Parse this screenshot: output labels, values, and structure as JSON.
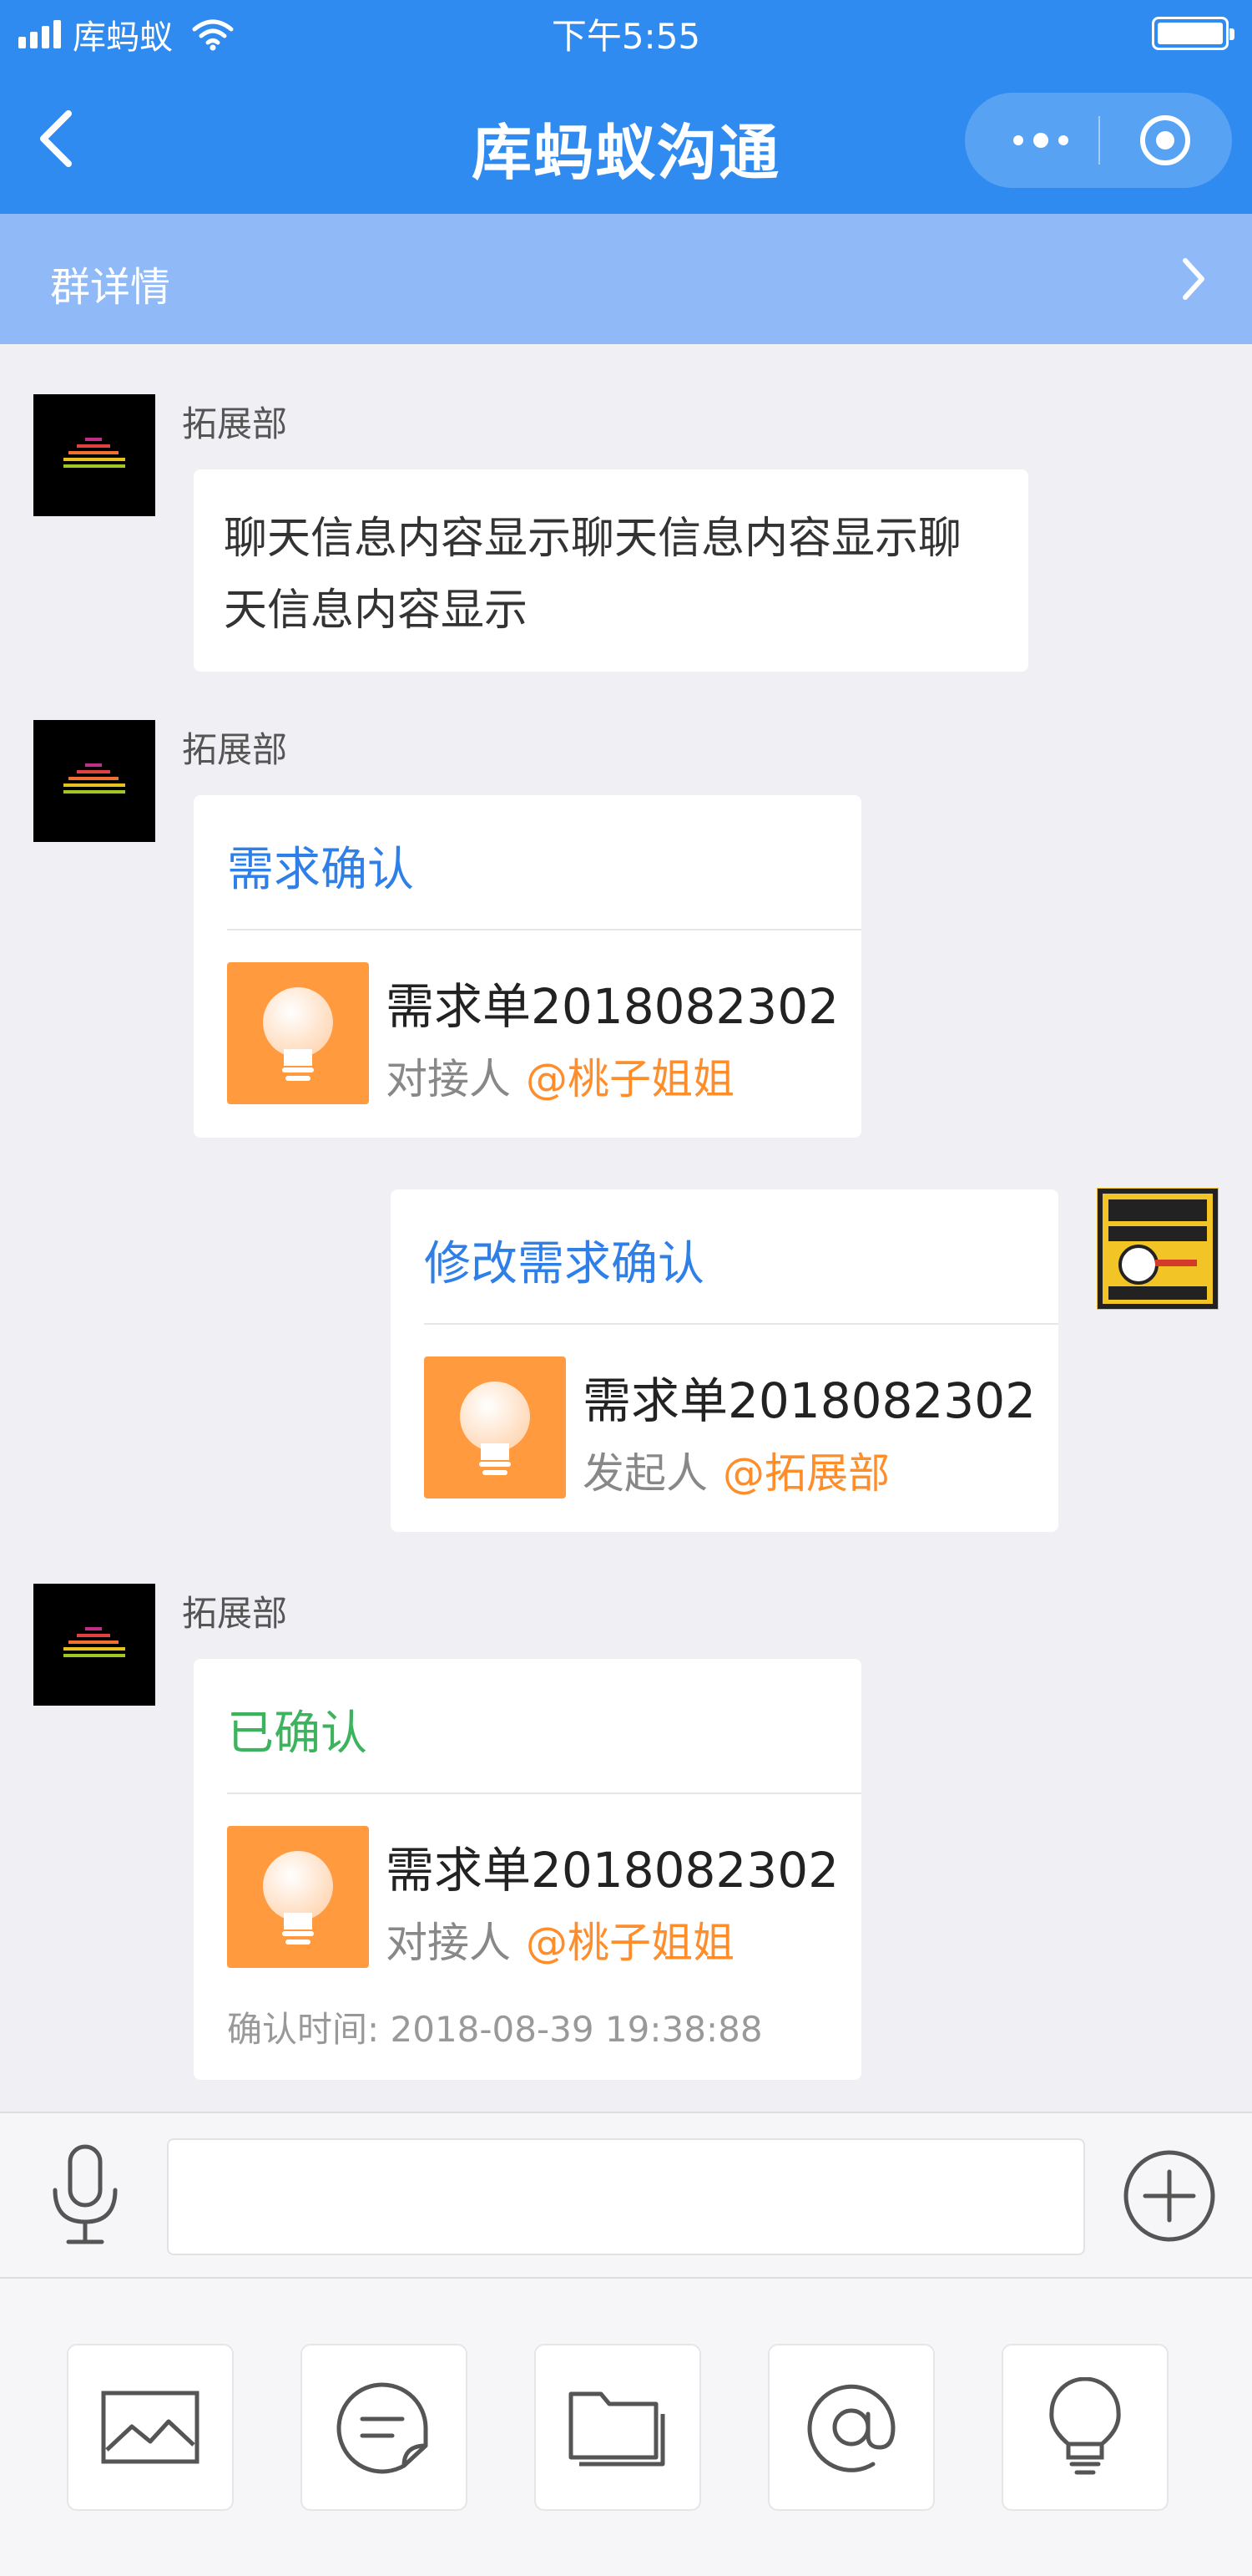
{
  "status_bar": {
    "carrier": "库蚂蚁",
    "time": "下午5:55"
  },
  "nav": {
    "title": "库蚂蚁沟通"
  },
  "group_bar": {
    "label": "群详情"
  },
  "messages": [
    {
      "type": "text",
      "side": "left",
      "sender": "拓展部",
      "text": "聊天信息内容显示聊天信息内容显示聊天信息内容显示"
    },
    {
      "type": "card",
      "side": "left",
      "sender": "拓展部",
      "title": "需求确认",
      "title_color": "#2f7fe8",
      "doc": "需求单2018082302",
      "person_label": "对接人",
      "mention": "@桃子姐姐"
    },
    {
      "type": "card",
      "side": "right",
      "title": "修改需求确认",
      "title_color": "#2f7fe8",
      "doc": "需求单2018082302",
      "person_label": "发起人",
      "mention": "@拓展部"
    },
    {
      "type": "card",
      "side": "left",
      "sender": "拓展部",
      "title": "已确认",
      "title_color": "#3cb35c",
      "doc": "需求单2018082302",
      "person_label": "对接人",
      "mention": "@桃子姐姐",
      "confirm_time": "确认时间: 2018-08-39 19:38:88"
    }
  ],
  "input": {
    "value": "",
    "placeholder": ""
  },
  "toolbar": {
    "icons": [
      "image-icon",
      "quick-reply-icon",
      "folder-icon",
      "at-icon",
      "lightbulb-icon"
    ]
  },
  "colors": {
    "primary": "#2f8bf0",
    "group_bar": "#8fb9f7",
    "accent_orange": "#ff9a3e",
    "mention": "#ff8d2a",
    "confirmed_green": "#3cb35c"
  }
}
